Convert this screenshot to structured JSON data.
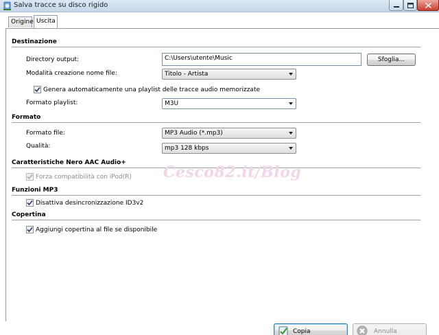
{
  "window": {
    "title": "Salva tracce su disco rigido"
  },
  "tabs": [
    {
      "label": "Origine",
      "active": false
    },
    {
      "label": "Uscita",
      "active": true
    }
  ],
  "destinazione": {
    "header": "Destinazione",
    "directory_label": "Directory output:",
    "directory_value": "C:\\Users\\utente\\Music",
    "browse_label": "Sfoglia...",
    "naming_label": "Modalità creazione nome file:",
    "naming_value": "Titolo - Artista",
    "playlist_checkbox_label": "Genera automaticamente una playlist delle tracce audio memorizzate",
    "playlist_checkbox_checked": true,
    "playlist_format_label": "Formato playlist:",
    "playlist_format_value": "M3U"
  },
  "formato": {
    "header": "Formato",
    "file_format_label": "Formato file:",
    "file_format_value": "MP3 Audio (*.mp3)",
    "quality_label": "Qualità:",
    "quality_value": "mp3 128 kbps"
  },
  "aac": {
    "header": "Caratteristiche Nero AAC Audio+",
    "ipod_label": "Forza compatibilità con iPod(R)",
    "ipod_checked": true,
    "ipod_enabled": false
  },
  "mp3": {
    "header": "Funzioni MP3",
    "id3_label": "Disattiva desincronizzazione ID3v2",
    "id3_checked": true
  },
  "copertina": {
    "header": "Copertina",
    "cover_label": "Aggiungi copertina al file se disponibile",
    "cover_checked": true
  },
  "watermark": "Cesco82.it/Blog",
  "footer": {
    "copy_label": "Copia",
    "cancel_label": "Annulla"
  },
  "colors": {
    "accent": "#3c7fb1",
    "watermark": "#f1d6ea",
    "copy_icon": "#3b9a2c",
    "cancel_icon": "#9a9a9a"
  }
}
